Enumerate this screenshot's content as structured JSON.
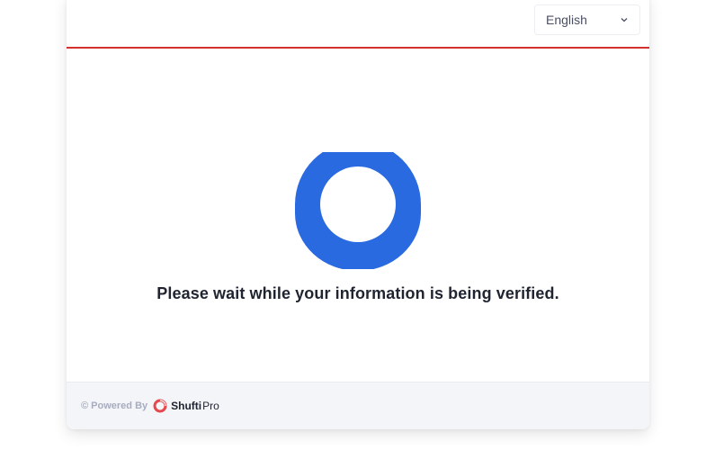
{
  "header": {
    "language": {
      "selected": "English",
      "chevron_icon": "chevron-down-icon"
    },
    "accent_color": "#d32f2f"
  },
  "main": {
    "spinner_icon": "loading-spinner-icon",
    "spinner_color": "#2a6ae0",
    "message": "Please wait while your information is being verified."
  },
  "footer": {
    "powered_by": "© Powered By",
    "brand_logo_icon": "shufti-logo-icon",
    "brand_part1": "Shufti",
    "brand_part2": "Pro",
    "brand_color": "#e5484d"
  }
}
